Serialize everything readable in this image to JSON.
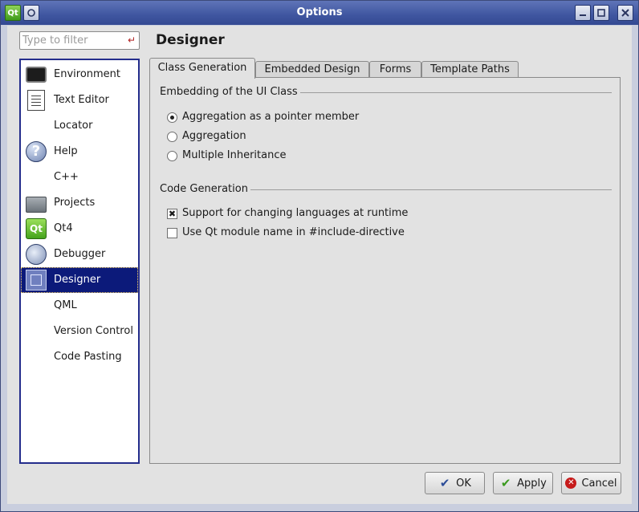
{
  "window": {
    "title": "Options",
    "app_icon_text": "Qt"
  },
  "filter": {
    "placeholder": "Type to filter",
    "value": ""
  },
  "categories": [
    {
      "label": "Environment",
      "icon": "environment-icon"
    },
    {
      "label": "Text Editor",
      "icon": "text-editor-icon"
    },
    {
      "label": "Locator",
      "icon": ""
    },
    {
      "label": "Help",
      "icon": "help-icon"
    },
    {
      "label": "C++",
      "icon": ""
    },
    {
      "label": "Projects",
      "icon": "projects-folder-icon"
    },
    {
      "label": "Qt4",
      "icon": "qt-icon"
    },
    {
      "label": "Debugger",
      "icon": "debugger-icon"
    },
    {
      "label": "Designer",
      "icon": "designer-icon",
      "selected": true
    },
    {
      "label": "QML",
      "icon": ""
    },
    {
      "label": "Version Control",
      "icon": ""
    },
    {
      "label": "Code Pasting",
      "icon": ""
    }
  ],
  "page": {
    "title": "Designer",
    "tabs": [
      "Class Generation",
      "Embedded Design",
      "Forms",
      "Template Paths"
    ],
    "active_tab": "Class Generation",
    "embedding_group": {
      "title": "Embedding of the UI Class",
      "options": [
        {
          "label": "Aggregation as a pointer member",
          "checked": true
        },
        {
          "label": "Aggregation",
          "checked": false
        },
        {
          "label": "Multiple Inheritance",
          "checked": false
        }
      ]
    },
    "codegen_group": {
      "title": "Code Generation",
      "options": [
        {
          "label": "Support for changing languages at runtime",
          "checked": true
        },
        {
          "label": "Use Qt module name in #include-directive",
          "checked": false
        }
      ]
    }
  },
  "buttons": {
    "ok": "OK",
    "apply": "Apply",
    "cancel": "Cancel"
  },
  "colors": {
    "titlebar": "#3f56a0",
    "selection": "#0c1a7a",
    "list_border": "#242d8c"
  }
}
